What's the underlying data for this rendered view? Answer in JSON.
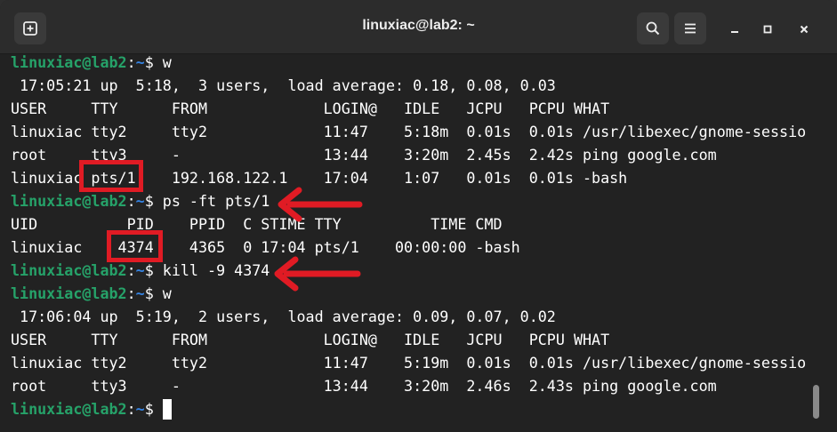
{
  "window": {
    "title": "linuxiac@lab2: ~"
  },
  "headerbar": {
    "new_tab_icon": "new-tab-plus-icon",
    "search_icon": "search-icon",
    "menu_icon": "hamburger-menu-icon",
    "minimize_icon": "minimize-icon",
    "maximize_icon": "maximize-icon",
    "close_icon": "close-icon"
  },
  "prompt": {
    "user_host": "linuxiac@lab2",
    "separator": ":",
    "path": "~",
    "dollar": "$ "
  },
  "terminal": {
    "lines": [
      {
        "type": "prompt",
        "cmd": "w"
      },
      {
        "type": "text",
        "text": " 17:05:21 up  5:18,  3 users,  load average: 0.18, 0.08, 0.03"
      },
      {
        "type": "text",
        "text": "USER     TTY      FROM             LOGIN@   IDLE   JCPU   PCPU WHAT"
      },
      {
        "type": "text",
        "text": "linuxiac tty2     tty2             11:47    5:18m  0.01s  0.01s /usr/libexec/gnome-sessio"
      },
      {
        "type": "text",
        "text": "root     tty3     -                13:44    3:20m  2.45s  2.42s ping google.com"
      },
      {
        "type": "text",
        "text": "linuxiac pts/1    192.168.122.1    17:04    1:07   0.01s  0.01s -bash"
      },
      {
        "type": "prompt",
        "cmd": "ps -ft pts/1"
      },
      {
        "type": "text",
        "text": "UID          PID    PPID  C STIME TTY          TIME CMD"
      },
      {
        "type": "text",
        "text": "linuxiac    4374    4365  0 17:04 pts/1    00:00:00 -bash"
      },
      {
        "type": "prompt",
        "cmd": "kill -9 4374"
      },
      {
        "type": "prompt",
        "cmd": "w"
      },
      {
        "type": "text",
        "text": " 17:06:04 up  5:19,  2 users,  load average: 0.09, 0.07, 0.02"
      },
      {
        "type": "text",
        "text": "USER     TTY      FROM             LOGIN@   IDLE   JCPU   PCPU WHAT"
      },
      {
        "type": "text",
        "text": "linuxiac tty2     tty2             11:47    5:19m  0.01s  0.01s /usr/libexec/gnome-sessio"
      },
      {
        "type": "text",
        "text": "root     tty3     -                13:44    3:20m  2.46s  2.43s ping google.com"
      },
      {
        "type": "prompt",
        "cmd": ""
      }
    ]
  },
  "annotations": {
    "highlight_color": "#e01b24",
    "highlights": [
      {
        "target": "pts/1"
      },
      {
        "target": "4374"
      }
    ]
  },
  "colors": {
    "prompt_user": "#26a269",
    "prompt_path": "#3584e4",
    "background": "#222222",
    "text": "#ffffff"
  }
}
